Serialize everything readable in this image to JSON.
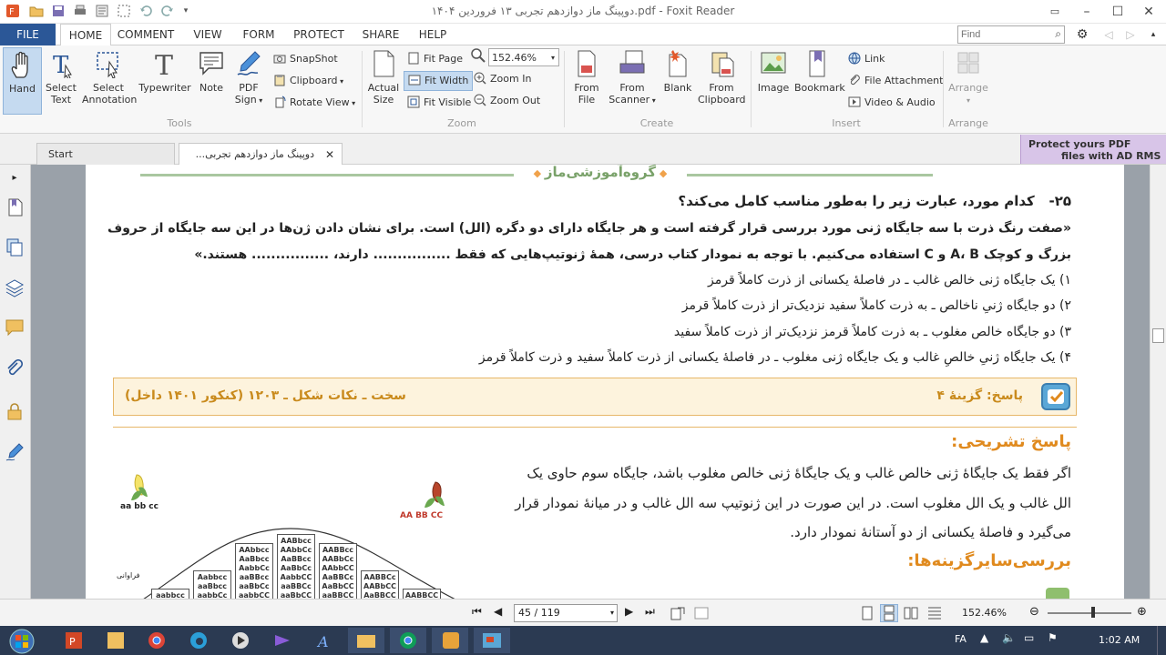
{
  "window": {
    "title": "دوپینگ ماز دوازدهم تجربی ۱۳ فروردین ۱۴۰۴.pdf - Foxit Reader"
  },
  "menu": {
    "tabs": [
      "FILE",
      "HOME",
      "COMMENT",
      "VIEW",
      "FORM",
      "PROTECT",
      "SHARE",
      "HELP"
    ],
    "active": "HOME",
    "find_placeholder": "Find"
  },
  "ribbon": {
    "tools": {
      "hand": "Hand",
      "select_text_1": "Select",
      "select_text_2": "Text",
      "select_annotation_1": "Select",
      "select_annotation_2": "Annotation",
      "typewriter": "Typewriter",
      "note": "Note",
      "pdf_sign_1": "PDF",
      "pdf_sign_2": "Sign",
      "snapshot": "SnapShot",
      "clipboard": "Clipboard",
      "rotate_view": "Rotate View",
      "group_label": "Tools"
    },
    "zoom": {
      "actual_size_1": "Actual",
      "actual_size_2": "Size",
      "fit_page": "Fit Page",
      "fit_width": "Fit Width",
      "fit_visible": "Fit Visible",
      "zoom_value": "152.46%",
      "zoom_in": "Zoom In",
      "zoom_out": "Zoom Out",
      "group_label": "Zoom"
    },
    "create": {
      "from_file_1": "From",
      "from_file_2": "File",
      "from_scanner_1": "From",
      "from_scanner_2": "Scanner",
      "blank": "Blank",
      "from_clipboard_1": "From",
      "from_clipboard_2": "Clipboard",
      "group_label": "Create"
    },
    "insert": {
      "image": "Image",
      "bookmark": "Bookmark",
      "link": "Link",
      "file_attachment": "File Attachment",
      "video_audio": "Video & Audio",
      "group_label": "Insert"
    },
    "arrange": {
      "arrange": "Arrange",
      "group_label": "Arrange"
    }
  },
  "doc_tabs": {
    "start": "Start",
    "current": "دوپینگ ماز دوازدهم تجربی...",
    "promo_1": "Protect yours PDF",
    "promo_2": "files with AD RMS"
  },
  "page": {
    "header_brand": "گروه‌آموزشی‌ماز",
    "question_number": "۲۵-",
    "question_title": "کدام مورد، عبارت زیر را به‌طور مناسب کامل می‌کند؟",
    "quote_line_1": "«صفت رنگ ذرت با سه جایگاه ژنی مورد بررسی قرار گرفته است و هر جایگاه دارای دو دگره (الل) است. برای نشان دادن ژن‌ها در این سه جایگاه از حروف",
    "quote_line_2": "بزرگ و کوچک A، B و C استفاده می‌کنیم. با توجه به نمودار کتاب درسی، همهٔ ژنوتیپ‌هایی که فقط ................ دارند، ................ هستند.»",
    "options": [
      "۱) یک جایگاه ژنی خالص غالب ـ در فاصلهٔ یکسانی از ذرت کاملاً قرمز",
      "۲) دو جایگاه ژنیِ ناخالص ـ به ذرت کاملاً سفید نزدیک‌تر از ذرت کاملاً قرمز",
      "۳) دو جایگاه خالص مغلوب ـ به ذرت کاملاً قرمز نزدیک‌تر از ذرت کاملاً سفید",
      "۴) یک جایگاه ژنیِ خالصِ غالب و یک جایگاه ژنی مغلوب ـ در فاصلهٔ یکسانی از ذرت کاملاً سفید و ذرت کاملاً قرمز"
    ],
    "answer_label": "پاسخ: گزینهٔ ۴",
    "answer_meta": "سخت ـ نکات شکل ـ ۱۲۰۳ (کنکور ۱۴۰۱ داخل)",
    "explanation_heading": "پاسخ تشریحی:",
    "explanation_lines": [
      "اگر فقط یک جایگاهٔ ژنی خالص غالب و یک جایگاهٔ ژنی خالص مغلوب باشد، جایگاه سوم حاوی یک",
      "الل غالب و یک الل مغلوب است. در این صورت در این ژنوتیپ سه الل غالب و در میانهٔ نمودار قرار",
      "می‌گیرد و فاصلهٔ یکسانی از دو آستانهٔ نمودار دارد."
    ],
    "other_options_heading": "بررسی‌سایرگزینه‌ها:",
    "figure": {
      "left_corn_label": "aa bb cc",
      "right_corn_label": "AA BB CC",
      "y_label": "فراوانی",
      "columns": [
        [
          "aabbcc"
        ],
        [
          "Aabbcc",
          "aaBbcc",
          "aabbCc"
        ],
        [
          "AAbbcc",
          "AaBbcc",
          "AabbCc",
          "aaBBcc",
          "aaBbCc",
          "aabbCC"
        ],
        [
          "AABbcc",
          "AAbbCc",
          "AaBBcc",
          "AaBbCc",
          "AabbCC",
          "aaBBCc",
          "aaBbCC"
        ],
        [
          "AABBcc",
          "AABbCc",
          "AAbbCC",
          "AaBBCc",
          "AaBbCC",
          "aaBBCC"
        ],
        [
          "AABBCc",
          "AABbCC",
          "AaBBCC"
        ],
        [
          "AABBCC"
        ]
      ]
    }
  },
  "status": {
    "page_indicator": "45 / 119",
    "zoom": "152.46%"
  },
  "taskbar": {
    "lang": "FA",
    "time": "1:02 AM"
  },
  "colors": {
    "accent": "#2b5797",
    "brand_green": "#7aa26a",
    "heading_orange": "#e08a1e",
    "answer_box_bg": "#fdf3dd",
    "answer_box_border": "#e7b769",
    "answer_text": "#c98a1c",
    "taskbar": "#2b3a52"
  }
}
